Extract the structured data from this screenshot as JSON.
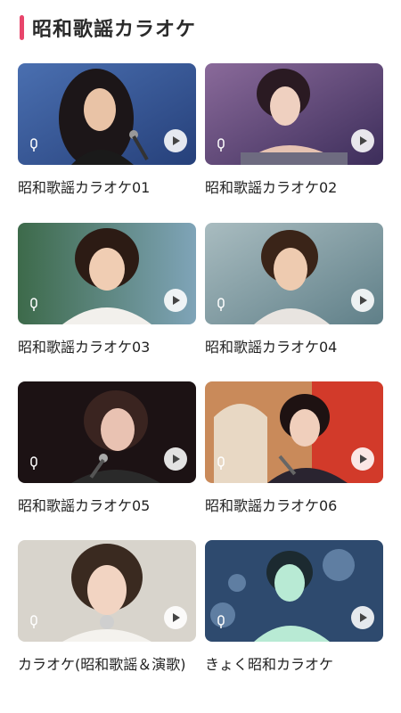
{
  "header": {
    "title": "昭和歌謡カラオケ",
    "accent": "#e8456b"
  },
  "cards": [
    {
      "title": "昭和歌謡カラオケ01",
      "icon": "play-icon"
    },
    {
      "title": "昭和歌謡カラオケ02",
      "icon": "play-icon"
    },
    {
      "title": "昭和歌謡カラオケ03",
      "icon": "play-icon"
    },
    {
      "title": "昭和歌謡カラオケ04",
      "icon": "play-icon"
    },
    {
      "title": "昭和歌謡カラオケ05",
      "icon": "play-icon"
    },
    {
      "title": "昭和歌謡カラオケ06",
      "icon": "play-icon"
    },
    {
      "title": "カラオケ(昭和歌謡＆演歌)",
      "icon": "play-icon"
    },
    {
      "title": "きょく昭和カラオケ",
      "icon": "play-icon"
    }
  ]
}
